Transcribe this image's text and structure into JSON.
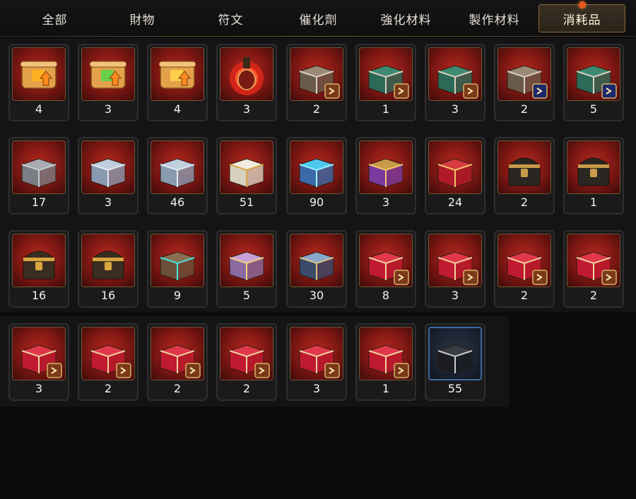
{
  "tabs": [
    {
      "label": "全部",
      "active": false
    },
    {
      "label": "財物",
      "active": false
    },
    {
      "label": "符文",
      "active": false
    },
    {
      "label": "催化劑",
      "active": false
    },
    {
      "label": "強化材料",
      "active": false
    },
    {
      "label": "製作材料",
      "active": false
    },
    {
      "label": "消耗品",
      "active": true,
      "notification": true
    }
  ],
  "inventory": {
    "items": [
      {
        "icon": "scroll-orange-icon",
        "qty": "4"
      },
      {
        "icon": "scroll-rainbow-icon",
        "qty": "3"
      },
      {
        "icon": "scroll-gold-icon",
        "qty": "4"
      },
      {
        "icon": "potion-bottle-icon",
        "qty": "3"
      },
      {
        "icon": "chest-silver-buff-icon",
        "qty": "2"
      },
      {
        "icon": "chest-green-chevron-icon",
        "qty": "1"
      },
      {
        "icon": "chest-green-dagger-icon",
        "qty": "3"
      },
      {
        "icon": "chest-silver-drop-icon",
        "qty": "2"
      },
      {
        "icon": "chest-green-axe-icon",
        "qty": "5"
      },
      {
        "icon": "box-iron-icon",
        "qty": "17"
      },
      {
        "icon": "box-steel-icon",
        "qty": "3"
      },
      {
        "icon": "box-steel-large-icon",
        "qty": "46"
      },
      {
        "icon": "box-white-gold-icon",
        "qty": "51"
      },
      {
        "icon": "box-crystal-icon",
        "qty": "90"
      },
      {
        "icon": "gift-box-purple-icon",
        "qty": "3"
      },
      {
        "icon": "gift-box-red-icon",
        "qty": "24"
      },
      {
        "icon": "chest-dark-gold-icon",
        "qty": "2"
      },
      {
        "icon": "chest-dark-gold-small-icon",
        "qty": "1"
      },
      {
        "icon": "treasure-chest-icon",
        "qty": "16"
      },
      {
        "icon": "treasure-chest-icon",
        "qty": "16"
      },
      {
        "icon": "ornate-box-cyan-icon",
        "qty": "9"
      },
      {
        "icon": "ornate-box-purple-icon",
        "qty": "5"
      },
      {
        "icon": "ornate-box-blue-icon",
        "qty": "30"
      },
      {
        "icon": "red-box-dagger-icon",
        "qty": "8"
      },
      {
        "icon": "red-box-heart-icon",
        "qty": "3"
      },
      {
        "icon": "red-box-swords-icon",
        "qty": "2"
      },
      {
        "icon": "red-box-chevron-icon",
        "qty": "2"
      },
      {
        "icon": "red-box-gear-icon",
        "qty": "3"
      },
      {
        "icon": "red-box-horn-icon",
        "qty": "2"
      },
      {
        "icon": "red-box-arm-icon",
        "qty": "2"
      },
      {
        "icon": "red-box-claw-icon",
        "qty": "2"
      },
      {
        "icon": "red-box-axe-icon",
        "qty": "3"
      },
      {
        "icon": "red-box-bow-icon",
        "qty": "1"
      },
      {
        "icon": "box-black-silver-icon",
        "qty": "55"
      }
    ]
  },
  "colors": {
    "accent": "#8a6a36",
    "notification": "#e55a1c",
    "slot_red": "#b52a1e",
    "slot_blue_border": "#3c6aa0"
  }
}
